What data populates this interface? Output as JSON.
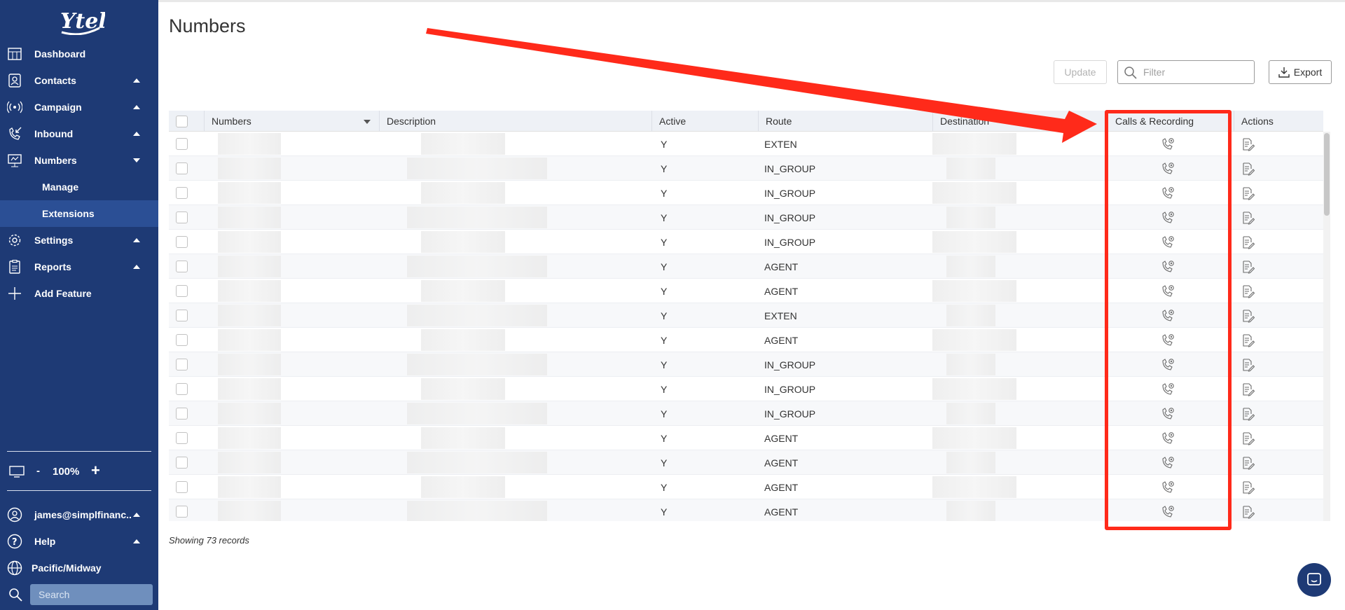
{
  "sidebar": {
    "brand": "Ytel",
    "nav": [
      {
        "label": "Dashboard",
        "icon": "dashboard-icon",
        "caret": ""
      },
      {
        "label": "Contacts",
        "icon": "contacts-icon",
        "caret": "up"
      },
      {
        "label": "Campaign",
        "icon": "campaign-icon",
        "caret": "up"
      },
      {
        "label": "Inbound",
        "icon": "inbound-icon",
        "caret": "up"
      },
      {
        "label": "Numbers",
        "icon": "numbers-icon",
        "caret": "down"
      }
    ],
    "sub_items": [
      {
        "label": "Manage",
        "active": false
      },
      {
        "label": "Extensions",
        "active": true
      }
    ],
    "nav2": [
      {
        "label": "Settings",
        "icon": "gear-icon",
        "caret": "up"
      },
      {
        "label": "Reports",
        "icon": "reports-icon",
        "caret": "up"
      },
      {
        "label": "Add Feature",
        "icon": "plus-icon",
        "caret": ""
      }
    ],
    "zoom": {
      "minus": "-",
      "value": "100%",
      "plus": "+"
    },
    "user": "james@simplfinanc..",
    "help": "Help",
    "timezone": "Pacific/Midway",
    "search_placeholder": "Search"
  },
  "main": {
    "title": "Numbers",
    "update_label": "Update",
    "filter_placeholder": "Filter",
    "export_label": "Export",
    "columns": [
      "Numbers",
      "Description",
      "Active",
      "Route",
      "Destination",
      "Calls & Recording",
      "Actions"
    ],
    "rows": [
      {
        "active": "Y",
        "route": "EXTEN"
      },
      {
        "active": "Y",
        "route": "IN_GROUP"
      },
      {
        "active": "Y",
        "route": "IN_GROUP"
      },
      {
        "active": "Y",
        "route": "IN_GROUP"
      },
      {
        "active": "Y",
        "route": "IN_GROUP"
      },
      {
        "active": "Y",
        "route": "AGENT"
      },
      {
        "active": "Y",
        "route": "AGENT"
      },
      {
        "active": "Y",
        "route": "EXTEN"
      },
      {
        "active": "Y",
        "route": "AGENT"
      },
      {
        "active": "Y",
        "route": "IN_GROUP"
      },
      {
        "active": "Y",
        "route": "IN_GROUP"
      },
      {
        "active": "Y",
        "route": "IN_GROUP"
      },
      {
        "active": "Y",
        "route": "AGENT"
      },
      {
        "active": "Y",
        "route": "AGENT"
      },
      {
        "active": "Y",
        "route": "AGENT"
      },
      {
        "active": "Y",
        "route": "AGENT"
      }
    ],
    "showing": "Showing 73 records"
  },
  "colors": {
    "sidebar_bg": "#1e3a75",
    "sidebar_active": "#2b4f95",
    "annotation_red": "#ff2a1a"
  }
}
